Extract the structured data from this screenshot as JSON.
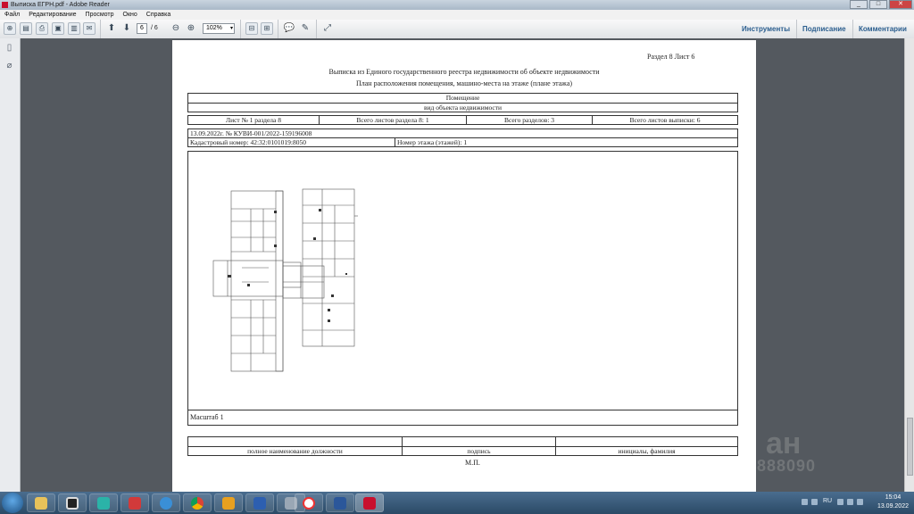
{
  "window": {
    "title": "Выписка ЕГРН.pdf - Adobe Reader",
    "controls": [
      "_",
      "□",
      "✕"
    ]
  },
  "menu": [
    "Файл",
    "Редактирование",
    "Просмотр",
    "Окно",
    "Справка"
  ],
  "toolbar": {
    "page_current": "6",
    "page_total": "/ 6",
    "zoom": "102%",
    "right_tabs": [
      "Инструменты",
      "Подписание",
      "Комментарии"
    ]
  },
  "document": {
    "header_right": "Раздел 8       Лист 6",
    "title": "Выписка из Единого государственного реестра недвижимости об объекте недвижимости",
    "subtitle": "План расположения помещения, машино-места на этаже (плане этажа)",
    "object_type_label": "Помещение",
    "object_type_caption": "вид объекта недвижимости",
    "sheet_info": {
      "sheet": "Лист № 1 раздела 8",
      "total_sheets_section": "Всего листов раздела 8: 1",
      "total_sections": "Всего разделов: 3",
      "total_sheets_extract": "Всего листов выписки: 6"
    },
    "date_number": "13.09.2022г. № КУВИ-001/2022-159196008",
    "cadastral_number": "Кадастровый номер: 42:32:0101019:8050",
    "floor_number": "Номер этажа (этажей): 1",
    "scale": "Масштаб 1",
    "signature_labels": {
      "position": "полное наименование должности",
      "signature": "подпись",
      "name": "инициалы, фамилия"
    },
    "stamp": "М.П."
  },
  "watermark": {
    "line1": "ан",
    "line2": "888090"
  },
  "taskbar": {
    "language": "RU",
    "time": "15:04",
    "date": "13.09.2022"
  },
  "colors": {
    "titlebar": "#b9c6d3",
    "accent": "#2a5d8e",
    "doc_bg": "#54595f",
    "taskbar": "#2b4a66"
  }
}
